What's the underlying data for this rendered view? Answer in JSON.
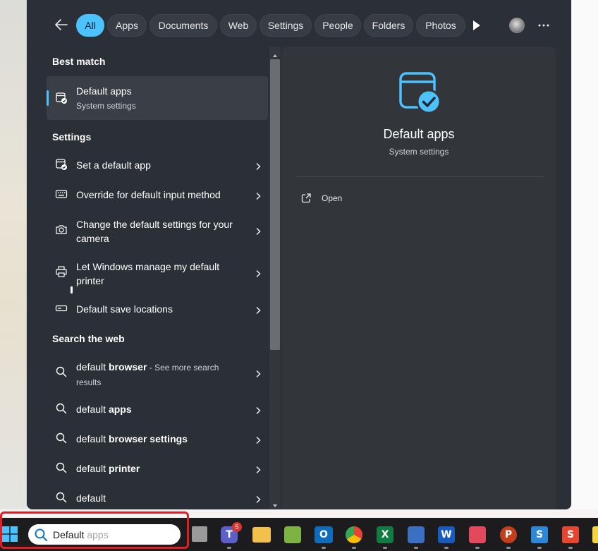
{
  "filters": [
    {
      "label": "All",
      "active": true
    },
    {
      "label": "Apps"
    },
    {
      "label": "Documents"
    },
    {
      "label": "Web"
    },
    {
      "label": "Settings"
    },
    {
      "label": "People"
    },
    {
      "label": "Folders"
    },
    {
      "label": "Photos"
    }
  ],
  "sections": {
    "best_match": "Best match",
    "settings": "Settings",
    "search_web": "Search the web"
  },
  "best_match_item": {
    "title": "Default apps",
    "subtitle": "System settings"
  },
  "settings_items": [
    {
      "label": "Set a default app"
    },
    {
      "label": "Override for default input method"
    },
    {
      "label": "Change the default settings for your camera"
    },
    {
      "label": "Let Windows manage my default printer"
    },
    {
      "label": "Default save locations"
    }
  ],
  "web_items": [
    {
      "prefix": "default ",
      "bold": "browser",
      "suffix": " - See more search results"
    },
    {
      "prefix": "default ",
      "bold": "apps",
      "suffix": ""
    },
    {
      "prefix": "default ",
      "bold": "browser settings",
      "suffix": ""
    },
    {
      "prefix": "default ",
      "bold": "printer",
      "suffix": ""
    },
    {
      "prefix": "default",
      "bold": "",
      "suffix": ""
    }
  ],
  "preview": {
    "title": "Default apps",
    "subtitle": "System settings",
    "open_label": "Open"
  },
  "taskbar": {
    "search_typed": "Default",
    "search_ghost": "apps",
    "teams_badge": "5"
  },
  "colors": {
    "accent": "#4cc2ff",
    "highlight": "#e01f25"
  }
}
